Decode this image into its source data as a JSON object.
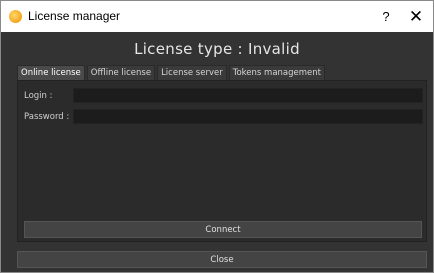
{
  "window": {
    "title": "License manager",
    "help_label": "?",
    "close_label": "✕"
  },
  "header": {
    "license_type": "License type : Invalid"
  },
  "tabs": [
    {
      "label": "Online license",
      "active": true
    },
    {
      "label": "Offline license",
      "active": false
    },
    {
      "label": "License server",
      "active": false
    },
    {
      "label": "Tokens management",
      "active": false
    }
  ],
  "online_license": {
    "login_label": "Login :",
    "login_value": "",
    "password_label": "Password :",
    "password_value": "",
    "connect_label": "Connect"
  },
  "footer": {
    "close_label": "Close"
  },
  "colors": {
    "background": "#333333",
    "panel": "#2b2b2b",
    "input": "#1c1c1c",
    "button": "#444444",
    "app_icon": "#f3a51c"
  }
}
